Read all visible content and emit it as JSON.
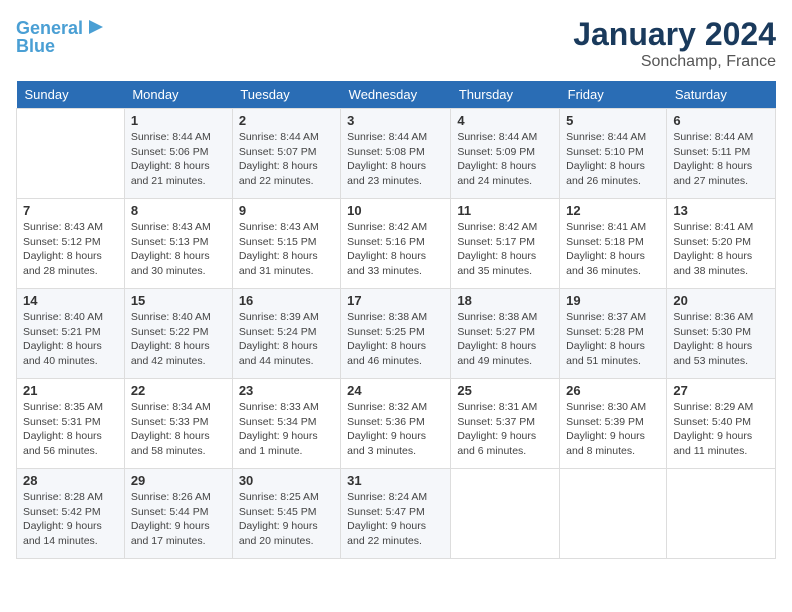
{
  "logo": {
    "line1": "General",
    "line2": "Blue"
  },
  "title": "January 2024",
  "location": "Sonchamp, France",
  "columns": [
    "Sunday",
    "Monday",
    "Tuesday",
    "Wednesday",
    "Thursday",
    "Friday",
    "Saturday"
  ],
  "weeks": [
    [
      {
        "day": "",
        "sunrise": "",
        "sunset": "",
        "daylight": ""
      },
      {
        "day": "1",
        "sunrise": "Sunrise: 8:44 AM",
        "sunset": "Sunset: 5:06 PM",
        "daylight": "Daylight: 8 hours and 21 minutes."
      },
      {
        "day": "2",
        "sunrise": "Sunrise: 8:44 AM",
        "sunset": "Sunset: 5:07 PM",
        "daylight": "Daylight: 8 hours and 22 minutes."
      },
      {
        "day": "3",
        "sunrise": "Sunrise: 8:44 AM",
        "sunset": "Sunset: 5:08 PM",
        "daylight": "Daylight: 8 hours and 23 minutes."
      },
      {
        "day": "4",
        "sunrise": "Sunrise: 8:44 AM",
        "sunset": "Sunset: 5:09 PM",
        "daylight": "Daylight: 8 hours and 24 minutes."
      },
      {
        "day": "5",
        "sunrise": "Sunrise: 8:44 AM",
        "sunset": "Sunset: 5:10 PM",
        "daylight": "Daylight: 8 hours and 26 minutes."
      },
      {
        "day": "6",
        "sunrise": "Sunrise: 8:44 AM",
        "sunset": "Sunset: 5:11 PM",
        "daylight": "Daylight: 8 hours and 27 minutes."
      }
    ],
    [
      {
        "day": "7",
        "sunrise": "Sunrise: 8:43 AM",
        "sunset": "Sunset: 5:12 PM",
        "daylight": "Daylight: 8 hours and 28 minutes."
      },
      {
        "day": "8",
        "sunrise": "Sunrise: 8:43 AM",
        "sunset": "Sunset: 5:13 PM",
        "daylight": "Daylight: 8 hours and 30 minutes."
      },
      {
        "day": "9",
        "sunrise": "Sunrise: 8:43 AM",
        "sunset": "Sunset: 5:15 PM",
        "daylight": "Daylight: 8 hours and 31 minutes."
      },
      {
        "day": "10",
        "sunrise": "Sunrise: 8:42 AM",
        "sunset": "Sunset: 5:16 PM",
        "daylight": "Daylight: 8 hours and 33 minutes."
      },
      {
        "day": "11",
        "sunrise": "Sunrise: 8:42 AM",
        "sunset": "Sunset: 5:17 PM",
        "daylight": "Daylight: 8 hours and 35 minutes."
      },
      {
        "day": "12",
        "sunrise": "Sunrise: 8:41 AM",
        "sunset": "Sunset: 5:18 PM",
        "daylight": "Daylight: 8 hours and 36 minutes."
      },
      {
        "day": "13",
        "sunrise": "Sunrise: 8:41 AM",
        "sunset": "Sunset: 5:20 PM",
        "daylight": "Daylight: 8 hours and 38 minutes."
      }
    ],
    [
      {
        "day": "14",
        "sunrise": "Sunrise: 8:40 AM",
        "sunset": "Sunset: 5:21 PM",
        "daylight": "Daylight: 8 hours and 40 minutes."
      },
      {
        "day": "15",
        "sunrise": "Sunrise: 8:40 AM",
        "sunset": "Sunset: 5:22 PM",
        "daylight": "Daylight: 8 hours and 42 minutes."
      },
      {
        "day": "16",
        "sunrise": "Sunrise: 8:39 AM",
        "sunset": "Sunset: 5:24 PM",
        "daylight": "Daylight: 8 hours and 44 minutes."
      },
      {
        "day": "17",
        "sunrise": "Sunrise: 8:38 AM",
        "sunset": "Sunset: 5:25 PM",
        "daylight": "Daylight: 8 hours and 46 minutes."
      },
      {
        "day": "18",
        "sunrise": "Sunrise: 8:38 AM",
        "sunset": "Sunset: 5:27 PM",
        "daylight": "Daylight: 8 hours and 49 minutes."
      },
      {
        "day": "19",
        "sunrise": "Sunrise: 8:37 AM",
        "sunset": "Sunset: 5:28 PM",
        "daylight": "Daylight: 8 hours and 51 minutes."
      },
      {
        "day": "20",
        "sunrise": "Sunrise: 8:36 AM",
        "sunset": "Sunset: 5:30 PM",
        "daylight": "Daylight: 8 hours and 53 minutes."
      }
    ],
    [
      {
        "day": "21",
        "sunrise": "Sunrise: 8:35 AM",
        "sunset": "Sunset: 5:31 PM",
        "daylight": "Daylight: 8 hours and 56 minutes."
      },
      {
        "day": "22",
        "sunrise": "Sunrise: 8:34 AM",
        "sunset": "Sunset: 5:33 PM",
        "daylight": "Daylight: 8 hours and 58 minutes."
      },
      {
        "day": "23",
        "sunrise": "Sunrise: 8:33 AM",
        "sunset": "Sunset: 5:34 PM",
        "daylight": "Daylight: 9 hours and 1 minute."
      },
      {
        "day": "24",
        "sunrise": "Sunrise: 8:32 AM",
        "sunset": "Sunset: 5:36 PM",
        "daylight": "Daylight: 9 hours and 3 minutes."
      },
      {
        "day": "25",
        "sunrise": "Sunrise: 8:31 AM",
        "sunset": "Sunset: 5:37 PM",
        "daylight": "Daylight: 9 hours and 6 minutes."
      },
      {
        "day": "26",
        "sunrise": "Sunrise: 8:30 AM",
        "sunset": "Sunset: 5:39 PM",
        "daylight": "Daylight: 9 hours and 8 minutes."
      },
      {
        "day": "27",
        "sunrise": "Sunrise: 8:29 AM",
        "sunset": "Sunset: 5:40 PM",
        "daylight": "Daylight: 9 hours and 11 minutes."
      }
    ],
    [
      {
        "day": "28",
        "sunrise": "Sunrise: 8:28 AM",
        "sunset": "Sunset: 5:42 PM",
        "daylight": "Daylight: 9 hours and 14 minutes."
      },
      {
        "day": "29",
        "sunrise": "Sunrise: 8:26 AM",
        "sunset": "Sunset: 5:44 PM",
        "daylight": "Daylight: 9 hours and 17 minutes."
      },
      {
        "day": "30",
        "sunrise": "Sunrise: 8:25 AM",
        "sunset": "Sunset: 5:45 PM",
        "daylight": "Daylight: 9 hours and 20 minutes."
      },
      {
        "day": "31",
        "sunrise": "Sunrise: 8:24 AM",
        "sunset": "Sunset: 5:47 PM",
        "daylight": "Daylight: 9 hours and 22 minutes."
      },
      {
        "day": "",
        "sunrise": "",
        "sunset": "",
        "daylight": ""
      },
      {
        "day": "",
        "sunrise": "",
        "sunset": "",
        "daylight": ""
      },
      {
        "day": "",
        "sunrise": "",
        "sunset": "",
        "daylight": ""
      }
    ]
  ]
}
